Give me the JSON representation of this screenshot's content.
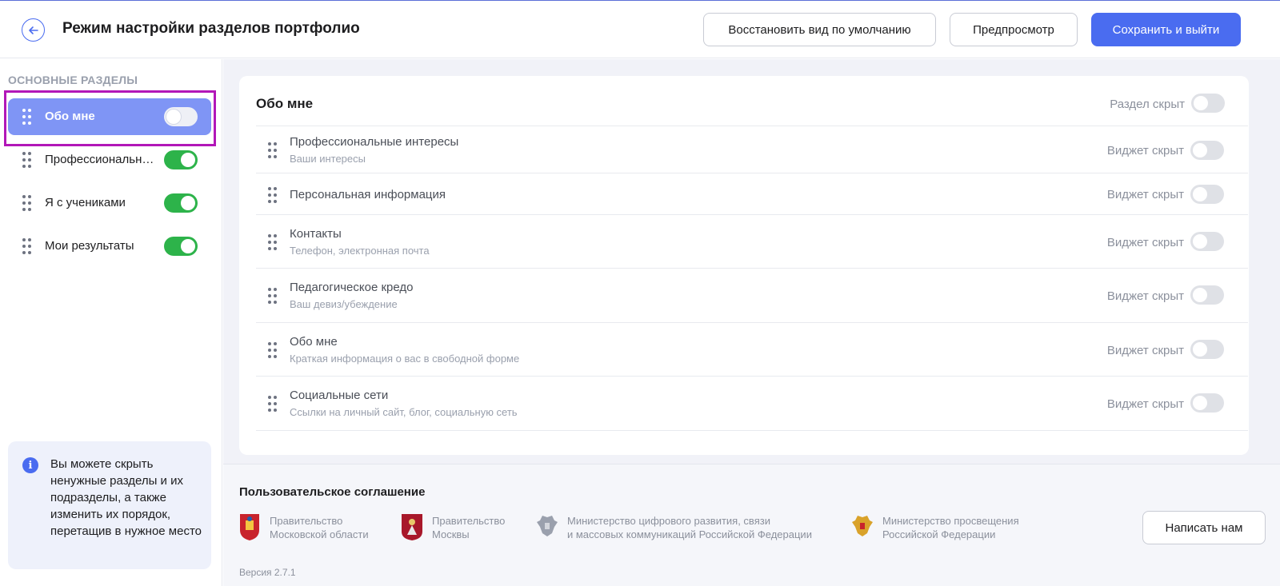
{
  "header": {
    "title": "Режим настройки разделов портфолио",
    "restore_label": "Восстановить вид по умолчанию",
    "preview_label": "Предпросмотр",
    "save_label": "Сохранить и выйти"
  },
  "sidebar": {
    "heading": "ОСНОВНЫЕ РАЗДЕЛЫ",
    "items": [
      {
        "label": "Обо мне",
        "enabled": false,
        "active": true
      },
      {
        "label": "Профессиональные интересы",
        "enabled": true,
        "active": false
      },
      {
        "label": "Я с учениками",
        "enabled": true,
        "active": false
      },
      {
        "label": "Мои результаты",
        "enabled": true,
        "active": false
      }
    ],
    "info_text": "Вы можете скрыть ненужные разделы и их подразделы, а также изменить их порядок, перетащив в нужное место"
  },
  "section": {
    "title": "Обо мне",
    "status": "Раздел скрыт",
    "enabled": false,
    "widgets": [
      {
        "title": "Профессиональные интересы",
        "subtitle": "Ваши интересы",
        "status": "Виджет скрыт",
        "enabled": false
      },
      {
        "title": "Персональная информация",
        "subtitle": "",
        "status": "Виджет скрыт",
        "enabled": false
      },
      {
        "title": "Контакты",
        "subtitle": "Телефон, электронная почта",
        "status": "Виджет скрыт",
        "enabled": false
      },
      {
        "title": "Педагогическое кредо",
        "subtitle": "Ваш девиз/убеждение",
        "status": "Виджет скрыт",
        "enabled": false
      },
      {
        "title": "Обо мне",
        "subtitle": "Краткая информация о вас в свободной форме",
        "status": "Виджет скрыт",
        "enabled": false
      },
      {
        "title": "Социальные сети",
        "subtitle": "Ссылки на личный сайт, блог, социальную сеть",
        "status": "Виджет скрыт",
        "enabled": false
      }
    ]
  },
  "footer": {
    "agreement": "Пользовательское соглашение",
    "partners": [
      {
        "line1": "Правительство",
        "line2": "Московской области",
        "icon": "moscow-region-emblem"
      },
      {
        "line1": "Правительство",
        "line2": "Москвы",
        "icon": "moscow-emblem"
      },
      {
        "line1": "Министерство цифрового развития, связи",
        "line2": "и массовых коммуникаций Российской Федерации",
        "icon": "russian-eagle-emblem"
      },
      {
        "line1": "Министерство просвещения",
        "line2": "Российской Федерации",
        "icon": "russian-eagle-gold-emblem"
      }
    ],
    "write_label": "Написать нам",
    "version": "Версия 2.7.1"
  },
  "colors": {
    "accent": "#4a6cf0",
    "active_item": "#7f95f5",
    "toggle_on": "#2db34a",
    "highlight": "#b217b8"
  }
}
